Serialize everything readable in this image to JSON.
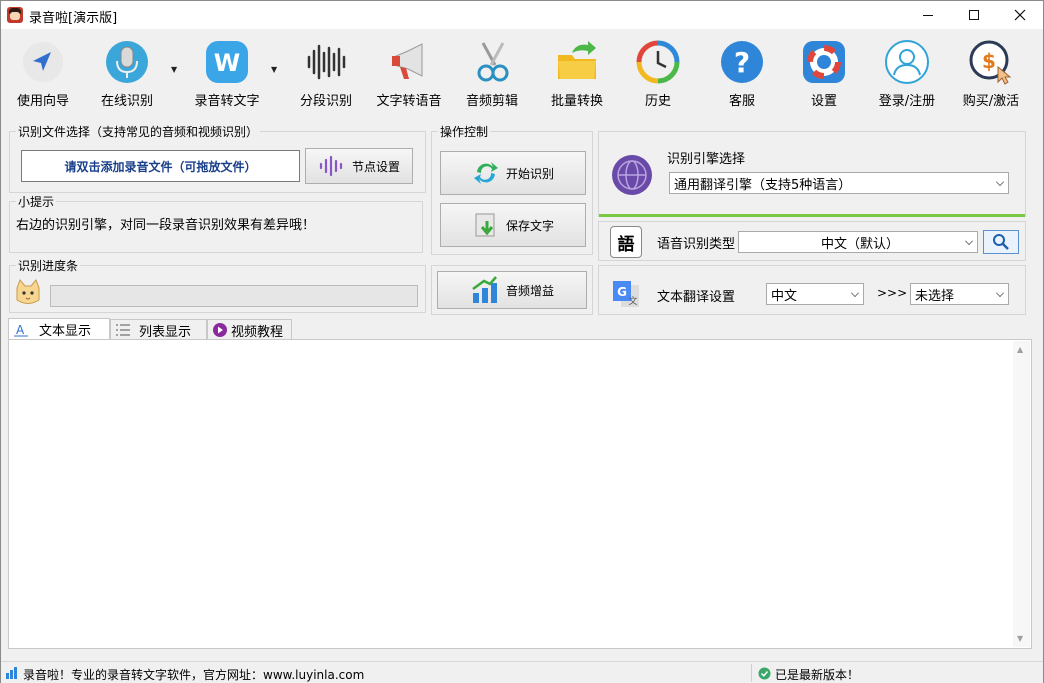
{
  "window": {
    "title": "录音啦[演示版]"
  },
  "toolbar": {
    "items": [
      {
        "label": "使用向导",
        "icon": "navigation-arrow-icon"
      },
      {
        "label": "在线识别",
        "icon": "microphone-icon"
      },
      {
        "label": "录音转文字",
        "icon": "w-badge-icon"
      },
      {
        "label": "分段识别",
        "icon": "waveform-icon"
      },
      {
        "label": "文字转语音",
        "icon": "megaphone-icon"
      },
      {
        "label": "音频剪辑",
        "icon": "scissors-icon"
      },
      {
        "label": "批量转换",
        "icon": "folder-arrow-icon"
      },
      {
        "label": "历史",
        "icon": "history-clock-icon"
      },
      {
        "label": "客服",
        "icon": "help-question-icon"
      },
      {
        "label": "设置",
        "icon": "lifebuoy-settings-icon"
      },
      {
        "label": "登录/注册",
        "icon": "user-icon"
      },
      {
        "label": "购买/激活",
        "icon": "dollar-cursor-icon"
      }
    ]
  },
  "file_select": {
    "group_title": "识别文件选择（支持常见的音频和视频识别）",
    "add_file_label": "请双击添加录音文件（可拖放文件）",
    "node_settings_label": "节点设置"
  },
  "tip": {
    "group_title": "小提示",
    "text": "右边的识别引擎，对同一段录音识别效果有差异哦！"
  },
  "progress": {
    "group_title": "识别进度条",
    "value": 0
  },
  "operation": {
    "group_title": "操作控制",
    "start_label": "开始识别",
    "save_label": "保存文字",
    "boost_label": "音频增益"
  },
  "engine": {
    "label": "识别引擎选择",
    "selected": "通用翻译引擎（支持5种语言）"
  },
  "speech_type": {
    "label": "语音识别类型",
    "selected": "中文（默认）",
    "badge": "語"
  },
  "translate": {
    "label": "文本翻译设置",
    "from": "中文",
    "arrows": ">>>",
    "to": "未选择"
  },
  "tabs": [
    {
      "label": "文本显示",
      "active": true
    },
    {
      "label": "列表显示",
      "active": false
    },
    {
      "label": "视频教程",
      "active": false
    }
  ],
  "status": {
    "left": "录音啦！专业的录音转文字软件，官方网址：www.luyinla.com",
    "right": "已是最新版本！"
  },
  "colors": {
    "accent_blue": "#1a3f8a",
    "engine_green": "#7ac943"
  }
}
